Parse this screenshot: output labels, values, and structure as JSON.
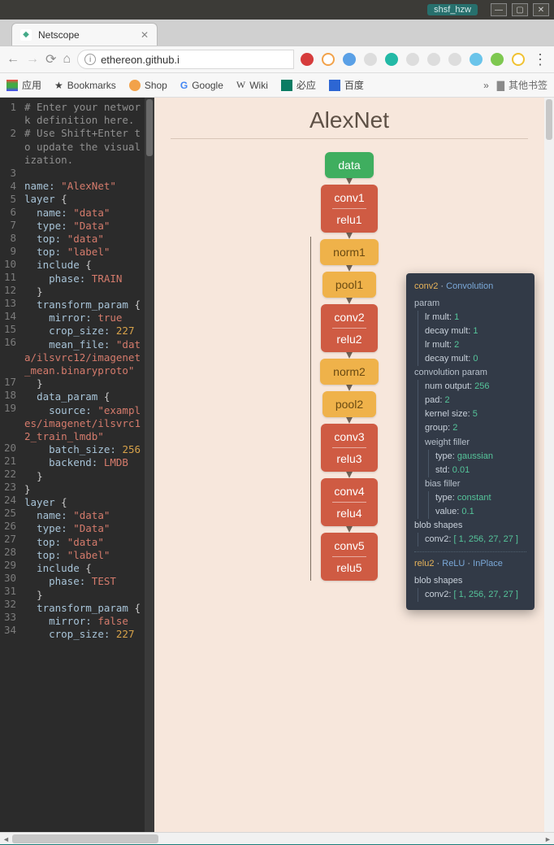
{
  "window": {
    "user_tag": "shsf_hzw"
  },
  "tab": {
    "title": "Netscope"
  },
  "url": {
    "display": "ethereon.github.i"
  },
  "bookmarks_bar": {
    "apps": "应用",
    "bookmarks": "Bookmarks",
    "shop": "Shop",
    "google": "Google",
    "wiki": "Wiki",
    "bing": "必应",
    "baidu": "百度",
    "overflow": "»",
    "other": "其他书签"
  },
  "diagram": {
    "title": "AlexNet",
    "nodes": [
      {
        "id": "data",
        "label1": "data",
        "kind": "data"
      },
      {
        "id": "conv1",
        "label1": "conv1",
        "label2": "relu1",
        "kind": "red"
      },
      {
        "id": "norm1",
        "label1": "norm1",
        "kind": "yel"
      },
      {
        "id": "pool1",
        "label1": "pool1",
        "kind": "yel"
      },
      {
        "id": "conv2",
        "label1": "conv2",
        "label2": "relu2",
        "kind": "red"
      },
      {
        "id": "norm2",
        "label1": "norm2",
        "kind": "yel"
      },
      {
        "id": "pool2",
        "label1": "pool2",
        "kind": "yel"
      },
      {
        "id": "conv3",
        "label1": "conv3",
        "label2": "relu3",
        "kind": "red"
      },
      {
        "id": "conv4",
        "label1": "conv4",
        "label2": "relu4",
        "kind": "red"
      },
      {
        "id": "conv5",
        "label1": "conv5",
        "label2": "relu5",
        "kind": "red"
      }
    ]
  },
  "tooltip": {
    "a": {
      "layer": "conv2",
      "type": "Convolution",
      "param_label": "param",
      "lr_mult_label": "lr mult:",
      "lr1": "1",
      "decay_mult_label": "decay mult:",
      "dm1": "1",
      "lr2": "2",
      "dm2": "0",
      "conv_param_label": "convolution param",
      "num_output_label": "num output:",
      "num_output": "256",
      "pad_label": "pad:",
      "pad": "2",
      "kernel_label": "kernel size:",
      "kernel": "5",
      "group_label": "group:",
      "group": "2",
      "wf_label": "weight filler",
      "wf_type_label": "type:",
      "wf_type": "gaussian",
      "wf_std_label": "std:",
      "wf_std": "0.01",
      "bf_label": "bias filler",
      "bf_type_label": "type:",
      "bf_type": "constant",
      "bf_value_label": "value:",
      "bf_value": "0.1",
      "blob_label": "blob shapes",
      "blob_name": "conv2:",
      "blob_shape": "[ 1, 256, 27, 27 ]"
    },
    "b": {
      "layer": "relu2",
      "type": "ReLU",
      "inplace": "InPlace",
      "blob_label": "blob shapes",
      "blob_name": "conv2:",
      "blob_shape": "[ 1, 256, 27, 27 ]"
    }
  },
  "editor": {
    "lines": [
      {
        "n": "1",
        "frags": [
          {
            "c": "cmt",
            "t": "# Enter your network definition here."
          }
        ]
      },
      {
        "n": "2",
        "frags": [
          {
            "c": "cmt",
            "t": "# Use Shift+Enter to update the visualization."
          }
        ]
      },
      {
        "n": "3",
        "frags": [
          {
            "c": "sym",
            "t": ""
          }
        ]
      },
      {
        "n": "4",
        "frags": [
          {
            "c": "key",
            "t": "name:"
          },
          {
            "c": "sym",
            "t": " "
          },
          {
            "c": "str",
            "t": "\"AlexNet\""
          }
        ]
      },
      {
        "n": "5",
        "frags": [
          {
            "c": "key",
            "t": "layer"
          },
          {
            "c": "sym",
            "t": " {"
          }
        ]
      },
      {
        "n": "6",
        "frags": [
          {
            "c": "sym",
            "t": "  "
          },
          {
            "c": "key",
            "t": "name:"
          },
          {
            "c": "sym",
            "t": " "
          },
          {
            "c": "str",
            "t": "\"data\""
          }
        ]
      },
      {
        "n": "7",
        "frags": [
          {
            "c": "sym",
            "t": "  "
          },
          {
            "c": "key",
            "t": "type:"
          },
          {
            "c": "sym",
            "t": " "
          },
          {
            "c": "str",
            "t": "\"Data\""
          }
        ]
      },
      {
        "n": "8",
        "frags": [
          {
            "c": "sym",
            "t": "  "
          },
          {
            "c": "key",
            "t": "top:"
          },
          {
            "c": "sym",
            "t": " "
          },
          {
            "c": "str",
            "t": "\"data\""
          }
        ]
      },
      {
        "n": "9",
        "frags": [
          {
            "c": "sym",
            "t": "  "
          },
          {
            "c": "key",
            "t": "top:"
          },
          {
            "c": "sym",
            "t": " "
          },
          {
            "c": "str",
            "t": "\"label\""
          }
        ]
      },
      {
        "n": "10",
        "frags": [
          {
            "c": "sym",
            "t": "  "
          },
          {
            "c": "key",
            "t": "include"
          },
          {
            "c": "sym",
            "t": " {"
          }
        ]
      },
      {
        "n": "11",
        "frags": [
          {
            "c": "sym",
            "t": "    "
          },
          {
            "c": "key",
            "t": "phase:"
          },
          {
            "c": "sym",
            "t": " "
          },
          {
            "c": "val",
            "t": "TRAIN"
          }
        ]
      },
      {
        "n": "12",
        "frags": [
          {
            "c": "sym",
            "t": "  }"
          }
        ]
      },
      {
        "n": "13",
        "frags": [
          {
            "c": "sym",
            "t": "  "
          },
          {
            "c": "key",
            "t": "transform_param"
          },
          {
            "c": "sym",
            "t": " {"
          }
        ]
      },
      {
        "n": "14",
        "frags": [
          {
            "c": "sym",
            "t": "    "
          },
          {
            "c": "key",
            "t": "mirror:"
          },
          {
            "c": "sym",
            "t": " "
          },
          {
            "c": "val",
            "t": "true"
          }
        ]
      },
      {
        "n": "15",
        "frags": [
          {
            "c": "sym",
            "t": "    "
          },
          {
            "c": "key",
            "t": "crop_size:"
          },
          {
            "c": "sym",
            "t": " "
          },
          {
            "c": "num",
            "t": "227"
          }
        ]
      },
      {
        "n": "16",
        "frags": [
          {
            "c": "sym",
            "t": "    "
          },
          {
            "c": "key",
            "t": "mean_file:"
          },
          {
            "c": "sym",
            "t": " "
          },
          {
            "c": "str",
            "t": "\"data/ilsvrc12/imagenet_mean.binaryproto\""
          }
        ]
      },
      {
        "n": "17",
        "frags": [
          {
            "c": "sym",
            "t": "  }"
          }
        ]
      },
      {
        "n": "18",
        "frags": [
          {
            "c": "sym",
            "t": "  "
          },
          {
            "c": "key",
            "t": "data_param"
          },
          {
            "c": "sym",
            "t": " {"
          }
        ]
      },
      {
        "n": "19",
        "frags": [
          {
            "c": "sym",
            "t": "    "
          },
          {
            "c": "key",
            "t": "source:"
          },
          {
            "c": "sym",
            "t": " "
          },
          {
            "c": "str",
            "t": "\"examples/imagenet/ilsvrc12_train_lmdb\""
          }
        ]
      },
      {
        "n": "20",
        "frags": [
          {
            "c": "sym",
            "t": "    "
          },
          {
            "c": "key",
            "t": "batch_size:"
          },
          {
            "c": "sym",
            "t": " "
          },
          {
            "c": "num",
            "t": "256"
          }
        ]
      },
      {
        "n": "21",
        "frags": [
          {
            "c": "sym",
            "t": "    "
          },
          {
            "c": "key",
            "t": "backend:"
          },
          {
            "c": "sym",
            "t": " "
          },
          {
            "c": "val",
            "t": "LMDB"
          }
        ]
      },
      {
        "n": "22",
        "frags": [
          {
            "c": "sym",
            "t": "  }"
          }
        ]
      },
      {
        "n": "23",
        "frags": [
          {
            "c": "sym",
            "t": "}"
          }
        ]
      },
      {
        "n": "24",
        "frags": [
          {
            "c": "key",
            "t": "layer"
          },
          {
            "c": "sym",
            "t": " {"
          }
        ]
      },
      {
        "n": "25",
        "frags": [
          {
            "c": "sym",
            "t": "  "
          },
          {
            "c": "key",
            "t": "name:"
          },
          {
            "c": "sym",
            "t": " "
          },
          {
            "c": "str",
            "t": "\"data\""
          }
        ]
      },
      {
        "n": "26",
        "frags": [
          {
            "c": "sym",
            "t": "  "
          },
          {
            "c": "key",
            "t": "type:"
          },
          {
            "c": "sym",
            "t": " "
          },
          {
            "c": "str",
            "t": "\"Data\""
          }
        ]
      },
      {
        "n": "27",
        "frags": [
          {
            "c": "sym",
            "t": "  "
          },
          {
            "c": "key",
            "t": "top:"
          },
          {
            "c": "sym",
            "t": " "
          },
          {
            "c": "str",
            "t": "\"data\""
          }
        ]
      },
      {
        "n": "28",
        "frags": [
          {
            "c": "sym",
            "t": "  "
          },
          {
            "c": "key",
            "t": "top:"
          },
          {
            "c": "sym",
            "t": " "
          },
          {
            "c": "str",
            "t": "\"label\""
          }
        ]
      },
      {
        "n": "29",
        "frags": [
          {
            "c": "sym",
            "t": "  "
          },
          {
            "c": "key",
            "t": "include"
          },
          {
            "c": "sym",
            "t": " {"
          }
        ]
      },
      {
        "n": "30",
        "frags": [
          {
            "c": "sym",
            "t": "    "
          },
          {
            "c": "key",
            "t": "phase:"
          },
          {
            "c": "sym",
            "t": " "
          },
          {
            "c": "val",
            "t": "TEST"
          }
        ]
      },
      {
        "n": "31",
        "frags": [
          {
            "c": "sym",
            "t": "  }"
          }
        ]
      },
      {
        "n": "32",
        "frags": [
          {
            "c": "sym",
            "t": "  "
          },
          {
            "c": "key",
            "t": "transform_param"
          },
          {
            "c": "sym",
            "t": " {"
          }
        ]
      },
      {
        "n": "33",
        "frags": [
          {
            "c": "sym",
            "t": "    "
          },
          {
            "c": "key",
            "t": "mirror:"
          },
          {
            "c": "sym",
            "t": " "
          },
          {
            "c": "val",
            "t": "false"
          }
        ]
      },
      {
        "n": "34",
        "frags": [
          {
            "c": "sym",
            "t": "    "
          },
          {
            "c": "key",
            "t": "crop_size:"
          },
          {
            "c": "sym",
            "t": " "
          },
          {
            "c": "num",
            "t": "227"
          }
        ]
      }
    ]
  }
}
